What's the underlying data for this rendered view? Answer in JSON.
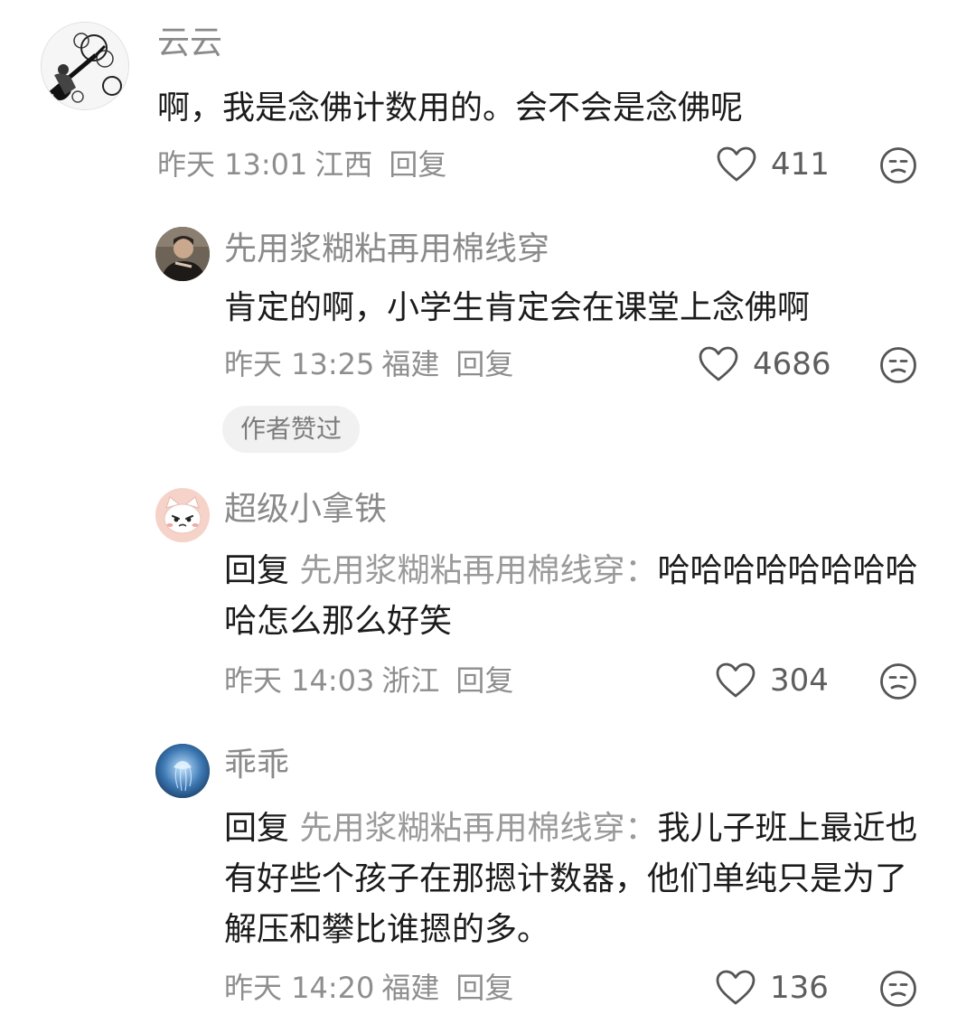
{
  "comments": [
    {
      "username": "云云",
      "text": "啊，我是念佛计数用的。会不会是念佛呢",
      "time": "昨天 13:01",
      "location": "江西",
      "reply_label": "回复",
      "likes": "411",
      "avatar_icon": "guitar-skull-sketch-avatar"
    },
    {
      "username": "先用浆糊粘再用棉线穿",
      "text": "肯定的啊，小学生肯定会在课堂上念佛啊",
      "time": "昨天 13:25",
      "location": "福建",
      "reply_label": "回复",
      "likes": "4686",
      "badge": "作者赞过",
      "avatar_icon": "person-photo-avatar"
    },
    {
      "username": "超级小拿铁",
      "reply_prefix": "回复",
      "reply_target": "先用浆糊粘再用棉线穿：",
      "text": "哈哈哈哈哈哈哈哈哈怎么那么好笑",
      "time": "昨天 14:03",
      "location": "浙江",
      "reply_label": "回复",
      "likes": "304",
      "avatar_icon": "cartoon-cat-avatar"
    },
    {
      "username": "乖乖",
      "reply_prefix": "回复",
      "reply_target": "先用浆糊粘再用棉线穿：",
      "text": "我儿子班上最近也有好些个孩子在那摁计数器，他们单纯只是为了解压和攀比谁摁的多。",
      "time": "昨天 14:20",
      "location": "福建",
      "reply_label": "回复",
      "likes": "136",
      "avatar_icon": "jellyfish-blue-avatar"
    }
  ],
  "colors": {
    "username": "#8a8a8a",
    "text": "#1b1b1b",
    "meta": "#8e8e8e",
    "badge_bg": "#f1f1f1"
  }
}
